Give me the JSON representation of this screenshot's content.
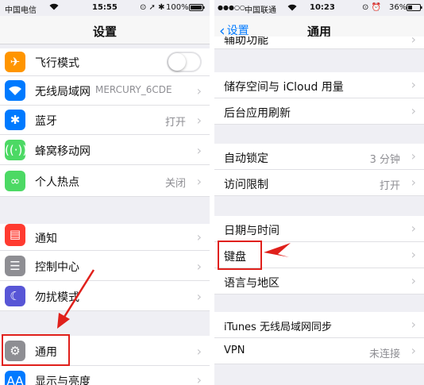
{
  "left": {
    "status": {
      "carrier": "中国电信",
      "time": "15:55",
      "battery": "100%"
    },
    "title": "设置",
    "rows": {
      "airplane": {
        "label": "飞行模式"
      },
      "wifi": {
        "label": "无线局域网",
        "value": "MERCURY_6CDE"
      },
      "bluetooth": {
        "label": "蓝牙",
        "value": "打开"
      },
      "cellular": {
        "label": "蜂窝移动网"
      },
      "hotspot": {
        "label": "个人热点",
        "value": "关闭"
      },
      "notifications": {
        "label": "通知"
      },
      "control_center": {
        "label": "控制中心"
      },
      "dnd": {
        "label": "勿扰模式"
      },
      "general": {
        "label": "通用"
      },
      "display": {
        "label": "显示与亮度"
      }
    }
  },
  "right": {
    "status": {
      "carrier": "中国联通",
      "time": "10:23",
      "battery": "36%"
    },
    "back_label": "设置",
    "title": "通用",
    "rows": {
      "accessibility": {
        "label": "辅助功能"
      },
      "storage": {
        "label": "储存空间与 iCloud 用量"
      },
      "background_refresh": {
        "label": "后台应用刷新"
      },
      "auto_lock": {
        "label": "自动锁定",
        "value": "3 分钟"
      },
      "restrictions": {
        "label": "访问限制",
        "value": "打开"
      },
      "date_time": {
        "label": "日期与时间"
      },
      "keyboard": {
        "label": "键盘"
      },
      "language_region": {
        "label": "语言与地区"
      },
      "itunes_sync": {
        "label": "iTunes 无线局域网同步"
      },
      "vpn": {
        "label": "VPN",
        "value": "未连接"
      }
    }
  },
  "glyphs": {
    "chevron": "›",
    "back_chevron": "‹"
  },
  "colors": {
    "accent": "#007aff",
    "airplane_icon": "#ff9500",
    "wifi_icon": "#007aff",
    "bluetooth_icon": "#007aff",
    "cellular_icon": "#4cd964",
    "hotspot_icon": "#4cd964",
    "notifications_icon": "#ff3b30",
    "control_center_icon": "#8e8e93",
    "dnd_icon": "#5856d6",
    "general_icon": "#8e8e93",
    "display_icon": "#007aff",
    "annotation": "#e0201b"
  }
}
